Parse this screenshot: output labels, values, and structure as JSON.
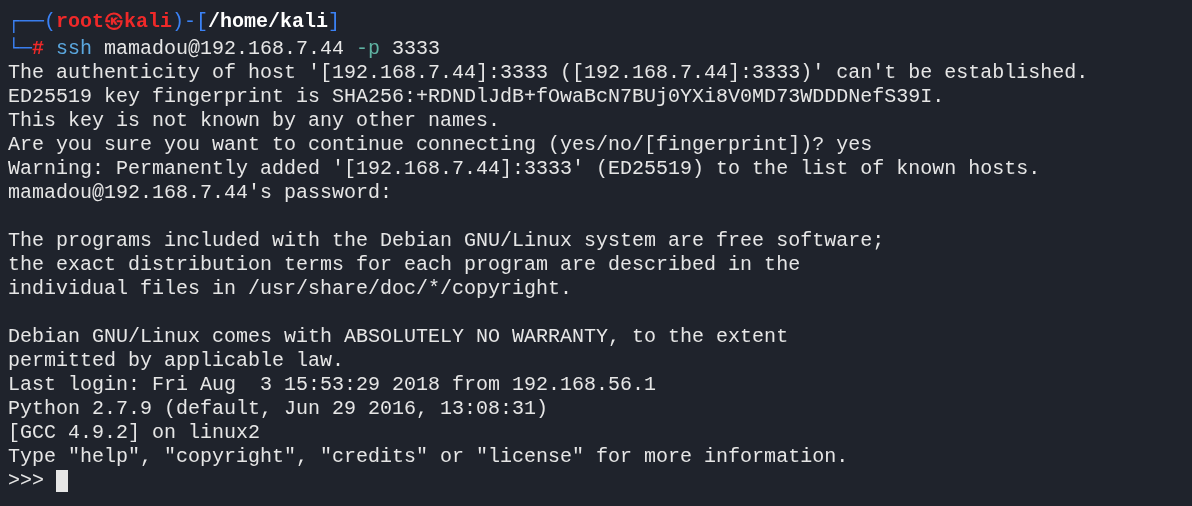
{
  "prompt": {
    "line1": [
      {
        "kind": "frame",
        "text": "┌──("
      },
      {
        "kind": "user",
        "text": "root㉿kali"
      },
      {
        "kind": "frame",
        "text": ")-["
      },
      {
        "kind": "path",
        "text": "/home/kali"
      },
      {
        "kind": "frame",
        "text": "]"
      }
    ],
    "line2": [
      {
        "kind": "frame",
        "text": "└─"
      },
      {
        "kind": "symbol",
        "text": "#"
      },
      {
        "kind": "command",
        "text": "ssh"
      },
      {
        "kind": "plain",
        "text": "mamadou@192.168.7.44"
      },
      {
        "kind": "option",
        "text": "-p"
      },
      {
        "kind": "plain",
        "text": "3333"
      }
    ]
  },
  "output_blocks": [
    [
      "The authenticity of host '[192.168.7.44]:3333 ([192.168.7.44]:3333)' can't be established.",
      "ED25519 key fingerprint is SHA256:+RDNDlJdB+fOwaBcN7BUj0YXi8V0MD73WDDDNefS39I.",
      "This key is not known by any other names.",
      "Are you sure you want to continue connecting (yes/no/[fingerprint])? yes",
      "Warning: Permanently added '[192.168.7.44]:3333' (ED25519) to the list of known hosts.",
      "mamadou@192.168.7.44's password:"
    ],
    [
      "The programs included with the Debian GNU/Linux system are free software;",
      "the exact distribution terms for each program are described in the",
      "individual files in /usr/share/doc/*/copyright."
    ],
    [
      "Debian GNU/Linux comes with ABSOLUTELY NO WARRANTY, to the extent",
      "permitted by applicable law.",
      "Last login: Fri Aug  3 15:53:29 2018 from 192.168.56.1",
      "Python 2.7.9 (default, Jun 29 2016, 13:08:31)",
      "[GCC 4.9.2] on linux2",
      "Type \"help\", \"copyright\", \"credits\" or \"license\" for more information."
    ]
  ],
  "repl_prompt": ">>>"
}
